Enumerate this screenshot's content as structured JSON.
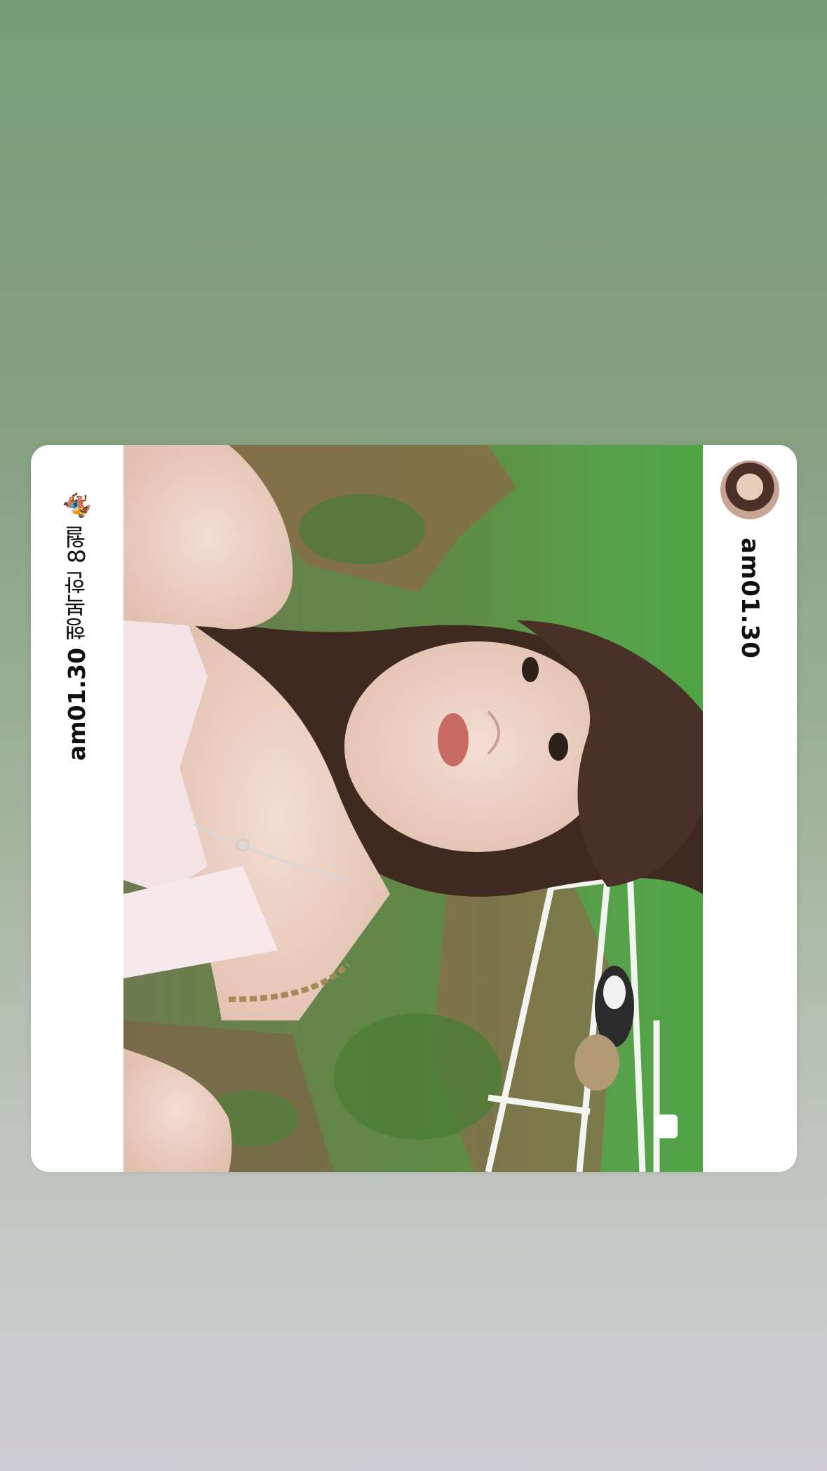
{
  "post": {
    "username": "am01.30",
    "caption_user": "am01.30",
    "caption_text": "행복한 8월",
    "caption_emoji": "🏇"
  },
  "colors": {
    "bg_top": "#769d74",
    "bg_bottom": "#cfcdd3",
    "card": "#ffffff"
  },
  "icons": {
    "avatar": "profile-avatar",
    "multi": "multiple-photos-icon"
  }
}
